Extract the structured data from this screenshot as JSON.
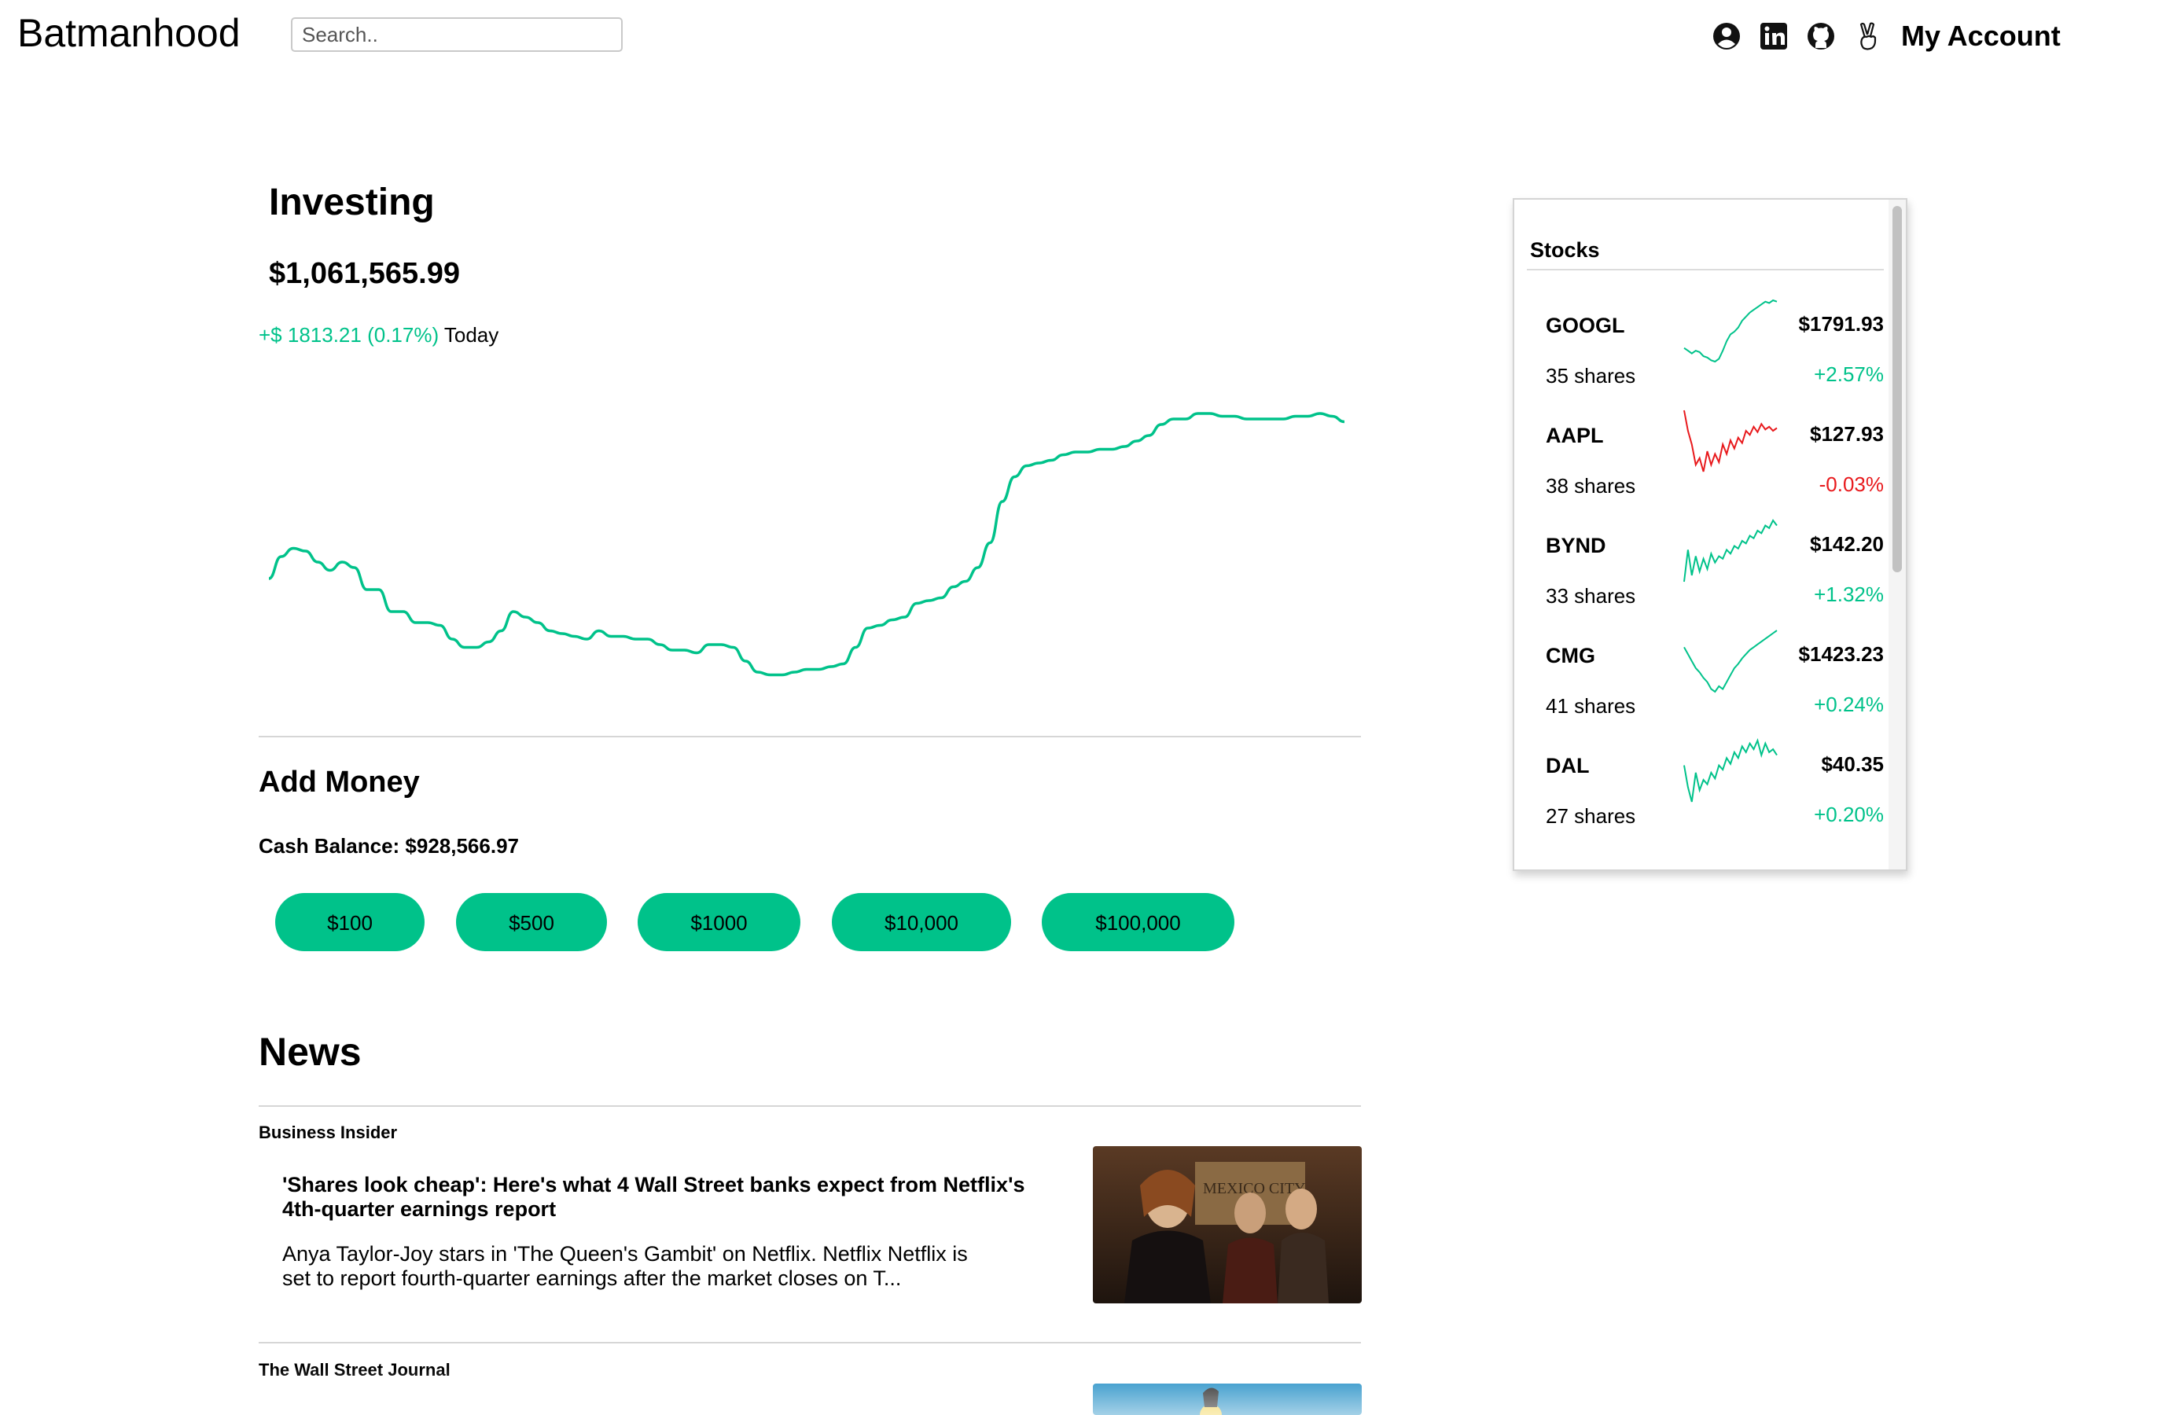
{
  "header": {
    "logo": "Batmanhood",
    "search_placeholder": "Search..",
    "icons": [
      "user-circle-icon",
      "linkedin-icon",
      "github-icon",
      "peace-hand-icon"
    ],
    "account_label": "My Account"
  },
  "investing": {
    "title": "Investing",
    "portfolio_value": "$1,061,565.99",
    "change": "+$ 1813.21 (0.17%)",
    "period": "Today",
    "positive_color": "#00c28a",
    "chart_data": {
      "type": "line",
      "series": [
        {
          "color": "#00c28a",
          "values": [
            52,
            60,
            63,
            62,
            58,
            55,
            58,
            56,
            48,
            48,
            40,
            40,
            36,
            36,
            35,
            30,
            27,
            27,
            29,
            33,
            40,
            38,
            36,
            33,
            32,
            31,
            30,
            33,
            31,
            31,
            30,
            30,
            28,
            26,
            26,
            25,
            28,
            28,
            27,
            22,
            18,
            17,
            17,
            18,
            19,
            19,
            20,
            21,
            27,
            34,
            35,
            37,
            38,
            43,
            44,
            45,
            49,
            51,
            56,
            65,
            80,
            89,
            93,
            94,
            95,
            97,
            98,
            98,
            99,
            99,
            100,
            102,
            104,
            108,
            110,
            110,
            112,
            112,
            111,
            111,
            110,
            110,
            110,
            110,
            111,
            111,
            112,
            111,
            109
          ],
          "ylim": [
            0,
            120
          ]
        }
      ]
    }
  },
  "add_money": {
    "title": "Add Money",
    "cash_balance": "Cash Balance: $928,566.97",
    "amounts": [
      "$100",
      "$500",
      "$1000",
      "$10,000",
      "$100,000"
    ]
  },
  "news": {
    "title": "News",
    "items": [
      {
        "source": "Business Insider",
        "headline": "'Shares look cheap': Here's what 4 Wall Street banks expect from Netflix's 4th-quarter earnings report",
        "summary": "Anya Taylor-Joy stars in 'The Queen's Gambit' on Netflix. Netflix Netflix is set to report fourth-quarter earnings after the market closes on T...",
        "image_sign": "MEXICO CITY"
      },
      {
        "source": "The Wall Street Journal"
      }
    ]
  },
  "stocks": {
    "title": "Stocks",
    "negative_color": "#e8191c",
    "items": [
      {
        "symbol": "GOOGL",
        "shares": "35 shares",
        "price": "$1791.93",
        "change": "+2.57%",
        "trend": "up",
        "spark": [
          40,
          38,
          36,
          38,
          37,
          34,
          33,
          31,
          30,
          32,
          38,
          45,
          50,
          52,
          55,
          60,
          63,
          66,
          68,
          70,
          72,
          74,
          73,
          75,
          74
        ]
      },
      {
        "symbol": "AAPL",
        "shares": "38 shares",
        "price": "$127.93",
        "change": "-0.03%",
        "trend": "down",
        "spark": [
          70,
          55,
          45,
          30,
          35,
          25,
          40,
          30,
          38,
          32,
          45,
          38,
          48,
          42,
          50,
          46,
          55,
          52,
          58,
          54,
          60,
          56,
          58,
          55,
          57
        ]
      },
      {
        "symbol": "BYND",
        "shares": "33 shares",
        "price": "$142.20",
        "change": "+1.32%",
        "trend": "up",
        "spark": [
          30,
          55,
          35,
          50,
          38,
          48,
          40,
          52,
          45,
          50,
          48,
          55,
          52,
          58,
          56,
          62,
          60,
          66,
          64,
          70,
          68,
          74,
          72,
          78,
          74
        ]
      },
      {
        "symbol": "CMG",
        "shares": "41 shares",
        "price": "$1423.23",
        "change": "+0.24%",
        "trend": "up",
        "spark": [
          60,
          55,
          50,
          45,
          42,
          38,
          35,
          30,
          28,
          32,
          30,
          35,
          40,
          45,
          48,
          52,
          55,
          58,
          60,
          62,
          64,
          66,
          68,
          70,
          72
        ]
      },
      {
        "symbol": "DAL",
        "shares": "27 shares",
        "price": "$40.35",
        "change": "+0.20%",
        "trend": "up",
        "spark": [
          55,
          40,
          30,
          50,
          38,
          45,
          42,
          50,
          46,
          55,
          52,
          60,
          56,
          64,
          60,
          68,
          64,
          70,
          66,
          72,
          62,
          70,
          64,
          66,
          62
        ]
      }
    ]
  }
}
